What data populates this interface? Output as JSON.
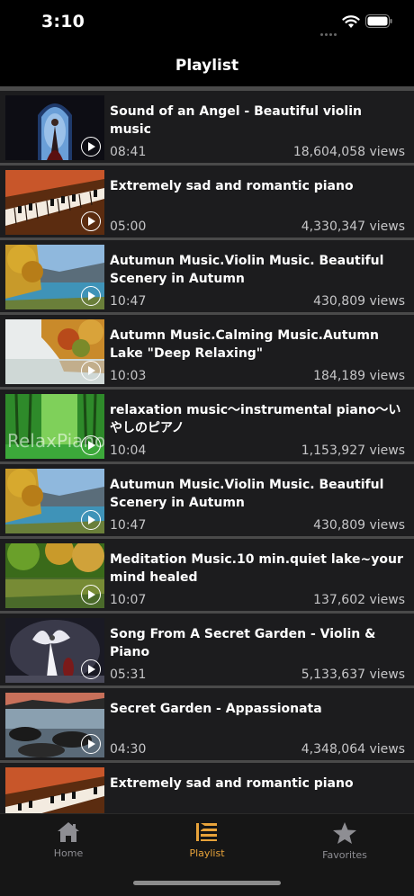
{
  "status": {
    "time": "3:10"
  },
  "nav": {
    "title": "Playlist"
  },
  "videos": [
    {
      "title": "Sound of an Angel - Beautiful violin music",
      "duration": "08:41",
      "views": "18,604,058 views"
    },
    {
      "title": "Extremely sad and romantic piano",
      "duration": "05:00",
      "views": "4,330,347 views"
    },
    {
      "title": "Autumun Music.Violin Music. Beautiful Scenery in Autumn",
      "duration": "10:47",
      "views": "430,809 views"
    },
    {
      "title": "Autumn Music.Calming Music.Autumn Lake \"Deep Relaxing\"",
      "duration": "10:03",
      "views": "184,189 views"
    },
    {
      "title": "relaxation music～instrumental piano～いやしのピアノ",
      "duration": "10:04",
      "views": "1,153,927 views",
      "thumb_text": "RelaxPiano"
    },
    {
      "title": "Autumun Music.Violin Music. Beautiful Scenery in Autumn",
      "duration": "10:47",
      "views": "430,809 views"
    },
    {
      "title": "Meditation  Music.10 min.quiet lake~your mind healed",
      "duration": "10:07",
      "views": "137,602 views"
    },
    {
      "title": "Song From A Secret Garden - Violin & Piano",
      "duration": "05:31",
      "views": "5,133,637 views"
    },
    {
      "title": "Secret Garden - Appassionata",
      "duration": "04:30",
      "views": "4,348,064 views"
    },
    {
      "title": "Extremely sad and romantic piano",
      "duration": "",
      "views": ""
    }
  ],
  "tabs": [
    {
      "label": "Home",
      "icon": "home-icon"
    },
    {
      "label": "Playlist",
      "icon": "playlist-icon",
      "active": true
    },
    {
      "label": "Favorites",
      "icon": "star-icon"
    }
  ],
  "colors": {
    "accent": "#e8a33a",
    "row_bg": "#1c1c1e",
    "inactive": "#8e8e93"
  }
}
